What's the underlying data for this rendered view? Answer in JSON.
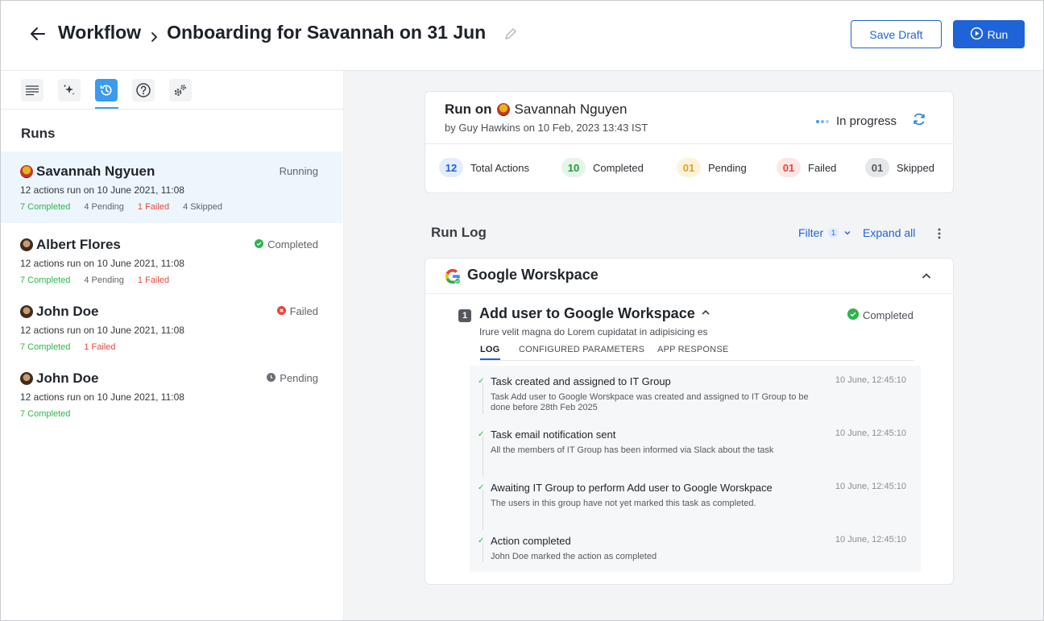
{
  "header": {
    "crumb_root": "Workflow",
    "crumb_current": "Onboarding for Savannah on 31 Jun",
    "save_draft_label": "Save Draft",
    "run_label": "Run"
  },
  "sidebar": {
    "toolbar_icons": [
      "list-icon",
      "sparkle-icon",
      "history-icon",
      "help-icon",
      "settings-gears-icon"
    ],
    "active_tool": "history-icon",
    "title": "Runs",
    "runs": [
      {
        "name": "Savannah Ngyuen",
        "status": "Running",
        "subtitle": "12 actions run on 10 June 2021, 11:08",
        "completed": "7 Completed",
        "pending": "4 Pending",
        "failed": "1 Failed",
        "skipped": "4 Skipped"
      },
      {
        "name": "Albert Flores",
        "status": "Completed",
        "subtitle": "12 actions run on 10 June 2021, 11:08",
        "completed": "7 Completed",
        "pending": "4 Pending",
        "failed": "1 Failed"
      },
      {
        "name": "John Doe",
        "status": "Failed",
        "subtitle": "12 actions run on 10 June 2021, 11:08",
        "completed": "7 Completed",
        "failed": "1 Failed"
      },
      {
        "name": "John Doe",
        "status": "Pending",
        "subtitle": "12 actions run on 10 June 2021, 11:08",
        "completed": "7 Completed"
      }
    ]
  },
  "summary": {
    "run_on_label": "Run on",
    "run_person": "Savannah Nguyen",
    "by_prefix": "by",
    "by_name": "Guy Hawkins",
    "on_text": "on 10 Feb, 2023 13:43 IST",
    "status": "In progress",
    "stats": [
      {
        "count": "12",
        "label": "Total Actions",
        "color": "#1f63d8",
        "bg": "#e3edfc"
      },
      {
        "count": "10",
        "label": "Completed",
        "color": "#1f9d3b",
        "bg": "#e3f6e7"
      },
      {
        "count": "01",
        "label": "Pending",
        "color": "#e0a21c",
        "bg": "#fdf3dc"
      },
      {
        "count": "01",
        "label": "Failed",
        "color": "#e5483d",
        "bg": "#fde6e4"
      },
      {
        "count": "01",
        "label": "Skipped",
        "color": "#55595e",
        "bg": "#e6e7e9"
      }
    ]
  },
  "runlog": {
    "title": "Run Log",
    "filter_label": "Filter",
    "filter_count": "1",
    "expand_all_label": "Expand all"
  },
  "app_section": {
    "title": "Google Worskpace",
    "action": {
      "number": "1",
      "title": "Add user to Google Workspace",
      "status": "Completed",
      "description": "Irure velit magna do Lorem cupidatat in adipisicing es",
      "tabs": [
        "LOG",
        "CONFIGURED PARAMETERS",
        "APP RESPONSE"
      ],
      "log": [
        {
          "title": "Task created and assigned to IT Group",
          "time": "10 June, 12:45:10",
          "desc": "Task Add user to Google Worskpace was created and assigned to IT Group to be done before 28th Feb 2025"
        },
        {
          "title": "Task email notification sent",
          "time": "10 June, 12:45:10",
          "desc": "All the members of IT Group has been informed via Slack about the task"
        },
        {
          "title": "Awaiting IT Group to perform Add user to Google Worskpace",
          "time": "10 June, 12:45:10",
          "desc": "The users in this group have not yet marked this task as completed."
        },
        {
          "title": "Action completed",
          "time": "10 June, 12:45:10",
          "desc": "John Doe marked the action as completed"
        }
      ]
    }
  },
  "colors": {
    "primary": "#1f63d8",
    "active_tool": "#3a9bf0",
    "success": "#2eb44a",
    "danger": "#e5483d"
  }
}
